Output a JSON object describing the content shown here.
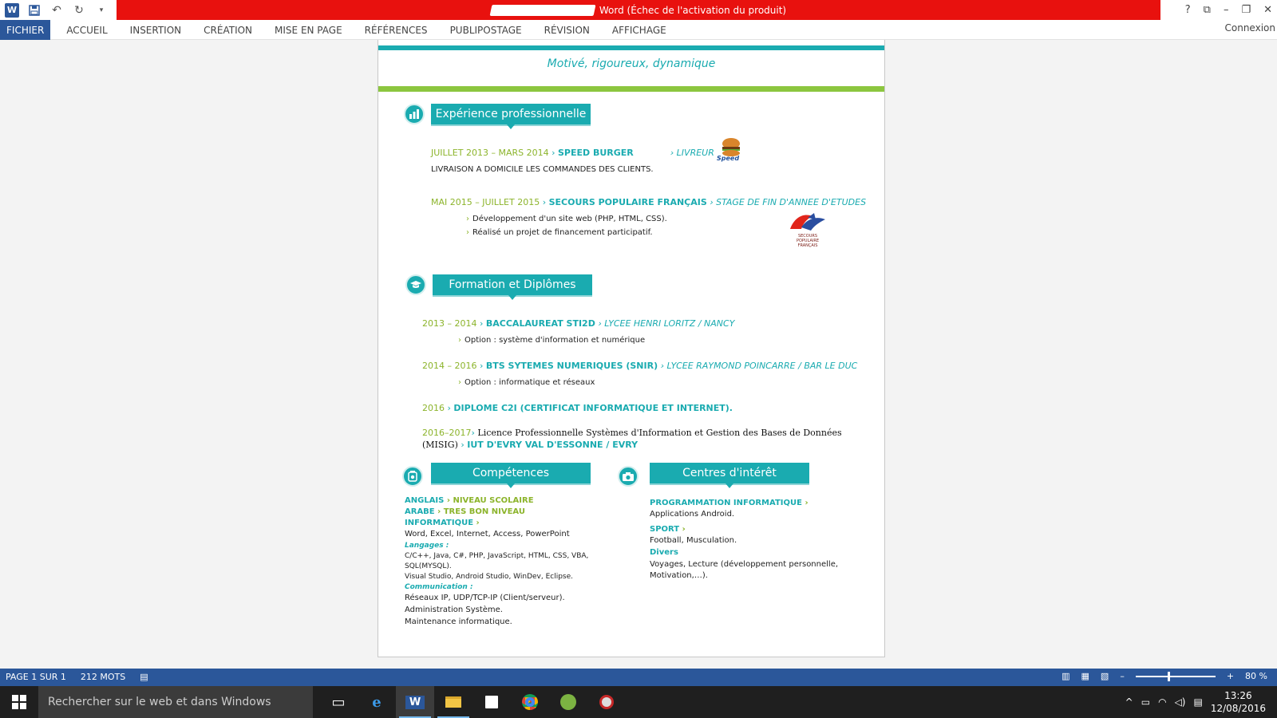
{
  "window": {
    "title": "Word (Échec de l'activation du produit)",
    "signin": "Connexion"
  },
  "quick_access": {
    "icons": [
      "word-logo",
      "save-icon",
      "undo-icon",
      "redo-icon",
      "customize-icon"
    ]
  },
  "window_controls": {
    "help": "?",
    "ribbon_options": "⧉",
    "minimize": "–",
    "restore": "❐",
    "close": "✕"
  },
  "ribbon": {
    "tabs": [
      "FICHIER",
      "ACCUEIL",
      "INSERTION",
      "CRÉATION",
      "MISE EN PAGE",
      "RÉFÉRENCES",
      "PUBLIPOSTAGE",
      "RÉVISION",
      "AFFICHAGE"
    ]
  },
  "doc": {
    "motto": "Motivé, rigoureux, dynamique",
    "exp": {
      "title": "Expérience professionnelle",
      "job1": {
        "dates": "JUILLET 2013 – MARS 2014",
        "sep": " › ",
        "company": "SPEED BURGER",
        "role": "› LIVREUR",
        "desc": "LIVRAISON A DOMICILE LES COMMANDES DES CLIENTS.",
        "logo_text": "Speed"
      },
      "job2": {
        "dates": "MAI 2015 – JUILLET 2015",
        "sep": " › ",
        "company": "SECOURS POPULAIRE FRANÇAIS",
        "role": " › STAGE DE FIN D'ANNEE D'ETUDES",
        "b1": "Développement d'un site web (PHP, HTML, CSS).",
        "b2": "Réalisé un projet de financement participatif.",
        "logo_text": "SECOURS POPULAIRE FRANÇAIS"
      }
    },
    "form": {
      "title": "Formation et Diplômes",
      "e1": {
        "dates": "2013 – 2014",
        "sep": " › ",
        "degree": "BACCALAUREAT STI2D",
        "school": " › LYCEE HENRI LORITZ / NANCY",
        "opt": "Option : système d'information et numérique"
      },
      "e2": {
        "dates": "2014 – 2016",
        "sep": " › ",
        "degree": "BTS SYTEMES NUMERIQUES (SNIR)",
        "school": " › LYCEE RAYMOND POINCARRE / BAR LE DUC",
        "opt": "Option : informatique et réseaux"
      },
      "e3": {
        "dates": "2016",
        "sep": " › ",
        "degree": "DIPLOME C2I (CERTIFICAT INFORMATIQUE ET INTERNET)."
      },
      "e4": {
        "dates": "2016–2017",
        "sep": "›",
        "text1": "Licence Professionnelle Systèmes d'Information et Gestion des Bases de Données",
        "text2": "(MISIG)",
        "sep2": " › ",
        "school": "IUT D'EVRY VAL D'ESSONNE / EVRY"
      }
    },
    "comp": {
      "title": "Compétences",
      "l1a": "ANGLAIS",
      "l1b": " › NIVEAU SCOLAIRE",
      "l2a": "ARABE",
      "l2b": " › TRES BON NIVEAU",
      "l3": "INFORMATIQUE",
      "l3b": " ›",
      "l4": "Word, Excel, Internet, Access, PowerPoint",
      "l5": "Langages :",
      "l6": " C/C++, Java, C#, PHP, JavaScript,   HTML, CSS, VBA,",
      "l7": "SQL(MYSQL).",
      "l8": "Visual Studio, Android Studio, WinDev, Eclipse.",
      "l9": "Communication :",
      "l10": "Réseaux IP, UDP/TCP-IP (Client/serveur).",
      "l11": "Administration Système.",
      "l12": "Maintenance informatique."
    },
    "interest": {
      "title": "Centres d'intérêt",
      "p1": "PROGRAMMATION INFORMATIQUE",
      "p1b": " ›",
      "p2": "Applications Android.",
      "s1": "SPORT",
      "s1b": " ›",
      "s2": "Football, Musculation.",
      "d1": "Divers",
      "d2": "Voyages, Lecture (développement personnelle,",
      "d3": "Motivation,…)."
    }
  },
  "status": {
    "page": "PAGE 1 SUR 1",
    "words": "212 MOTS",
    "zoom": "80 %",
    "zoom_fraction": 0.4
  },
  "taskbar": {
    "search_placeholder": "Rechercher sur le web et dans Windows",
    "time": "13:26",
    "date": "12/08/2016"
  },
  "colors": {
    "word_blue": "#2b579a",
    "teal": "#1aabb0",
    "green": "#8cb42b",
    "red": "#e8110e"
  }
}
